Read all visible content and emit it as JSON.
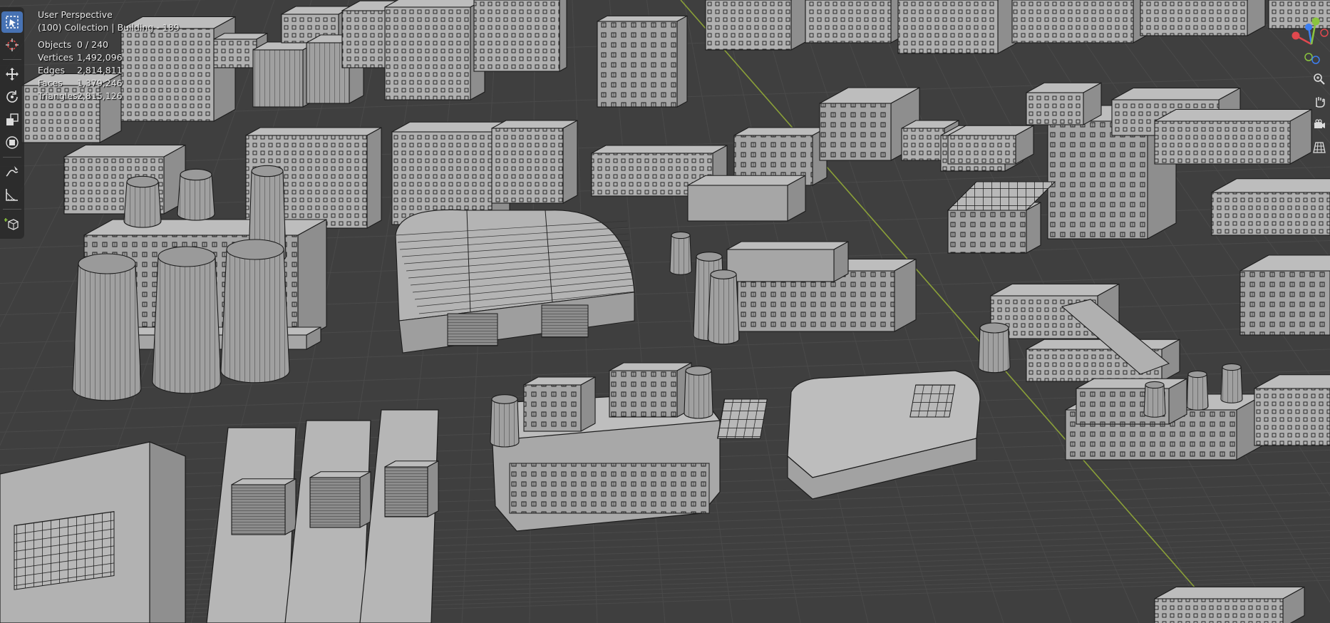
{
  "viewport": {
    "view_name": "User Perspective",
    "collection_line": "(100) Collection | Building - 189",
    "stats": [
      {
        "label": "Objects",
        "value": "0 / 240"
      },
      {
        "label": "Vertices",
        "value": "1,492,096"
      },
      {
        "label": "Edges",
        "value": "2,814,811"
      },
      {
        "label": "Faces",
        "value": "1,379,246"
      },
      {
        "label": "Triangles",
        "value": "2,815,126"
      }
    ]
  },
  "toolbar": {
    "tools": [
      "select-box-icon",
      "cursor-icon",
      "move-icon",
      "rotate-icon",
      "scale-icon",
      "transform-icon",
      "annotate-icon",
      "measure-icon",
      "add-cube-icon"
    ],
    "active_tool": "select-box-icon"
  },
  "navigation": {
    "gizmo_axes": {
      "x": "#e0484e",
      "y": "#8ac43f",
      "z": "#3d7ff2"
    },
    "buttons": [
      "zoom-icon",
      "pan-hand-icon",
      "camera-icon",
      "perspective-grid-icon"
    ]
  },
  "colors": {
    "background": "#3f3f3f",
    "grid_line": "#4a4a4a",
    "y_axis_line": "#8aa038",
    "building_face": "#a6a6a6",
    "building_top": "#bdbdbd",
    "building_side": "#8e8e8e",
    "wire": "#1c1c1c",
    "accent": "#4772b3"
  }
}
